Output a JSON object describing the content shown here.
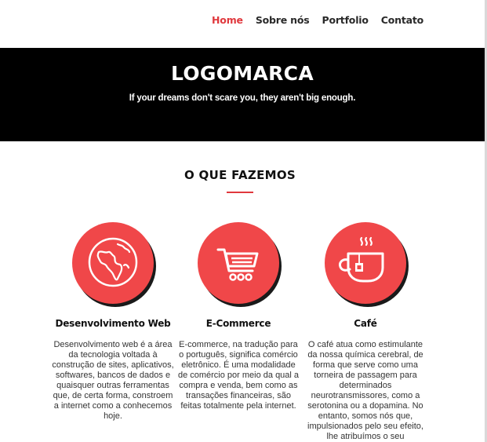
{
  "nav": {
    "items": [
      "Home",
      "Sobre nós",
      "Portfolio",
      "Contato"
    ],
    "active_index": 0
  },
  "hero": {
    "logo": "LOGOMARCA",
    "tagline": "If your dreams don't scare you, they aren't big enough."
  },
  "section": {
    "title": "O QUE FAZEMOS"
  },
  "features": [
    {
      "icon": "globe-icon",
      "title": "Desenvolvimento Web",
      "text": "Desenvolvimento web é a área da tecnologia voltada à construção de sites, aplicativos, softwares, bancos de dados e quaisquer outras ferramentas que, de certa forma, constroem a internet como a conhecemos hoje."
    },
    {
      "icon": "shopping-cart-icon",
      "title": "E-Commerce",
      "text": "E-commerce, na tradução para o português, significa comércio eletrônico. É uma modalidade de comércio por meio da qual a compra e venda, bem como as transações financeiras, são feitas totalmente pela internet."
    },
    {
      "icon": "coffee-cup-icon",
      "title": "Café",
      "text": "O café atua como estimulante da nossa química cerebral, de forma que serve como uma torneira de passagem para determinados neurotransmissores, como a serotonina ou a dopamina. No entanto, somos nós que, impulsionados pelo seu efeito, lhe atribuímos o seu"
    }
  ],
  "colors": {
    "accent": "#f04749",
    "nav_active": "#e0383d",
    "hero_bg": "#000000"
  }
}
